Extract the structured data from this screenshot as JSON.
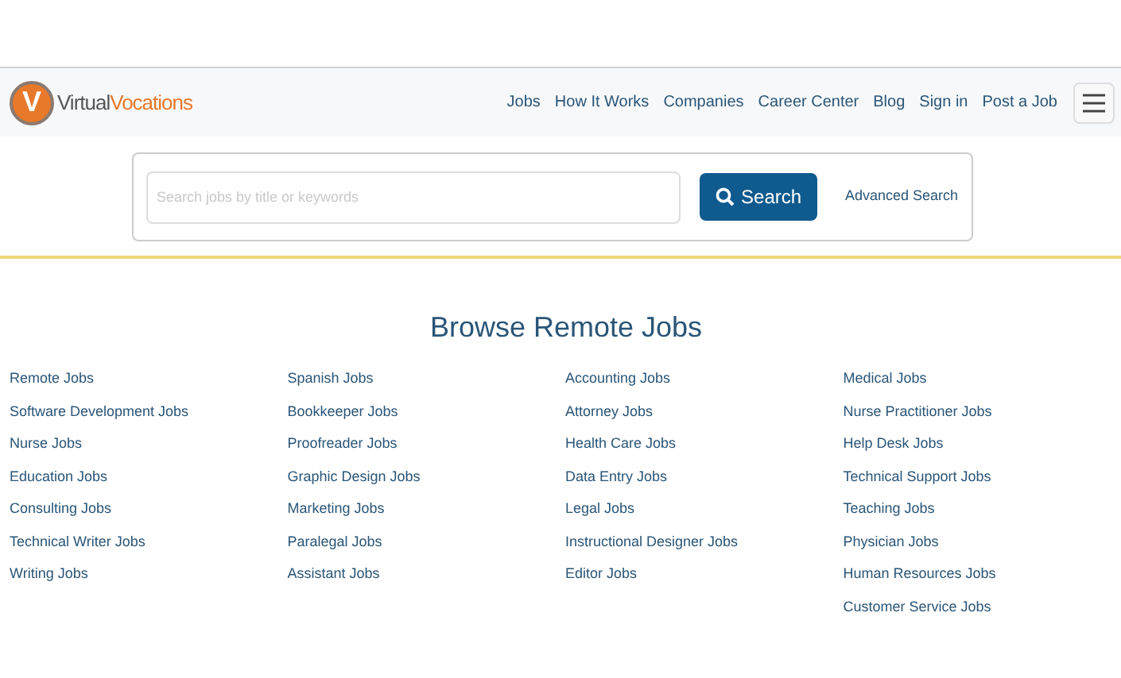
{
  "header": {
    "logo_letter": "V",
    "logo_text_1": "Virtual",
    "logo_text_2": "Vocations",
    "nav": [
      "Jobs",
      "How It Works",
      "Companies",
      "Career Center",
      "Blog",
      "Sign in",
      "Post a Job"
    ]
  },
  "search": {
    "placeholder": "Search jobs by title or keywords",
    "button": "Search",
    "advanced": "Advanced Search"
  },
  "browse": {
    "title": "Browse Remote Jobs",
    "columns": [
      [
        "Remote Jobs",
        "Software Development Jobs",
        "Nurse Jobs",
        "Education Jobs",
        "Consulting Jobs",
        "Technical Writer Jobs",
        "Writing Jobs"
      ],
      [
        "Spanish Jobs",
        "Bookkeeper Jobs",
        "Proofreader Jobs",
        "Graphic Design Jobs",
        "Marketing Jobs",
        "Paralegal Jobs",
        "Assistant Jobs"
      ],
      [
        "Accounting Jobs",
        "Attorney Jobs",
        "Health Care Jobs",
        "Data Entry Jobs",
        "Legal Jobs",
        "Instructional Designer Jobs",
        "Editor Jobs"
      ],
      [
        "Medical Jobs",
        "Nurse Practitioner Jobs",
        "Help Desk Jobs",
        "Technical Support Jobs",
        "Teaching Jobs",
        "Physician Jobs",
        "Human Resources Jobs",
        "Customer Service Jobs"
      ]
    ]
  }
}
